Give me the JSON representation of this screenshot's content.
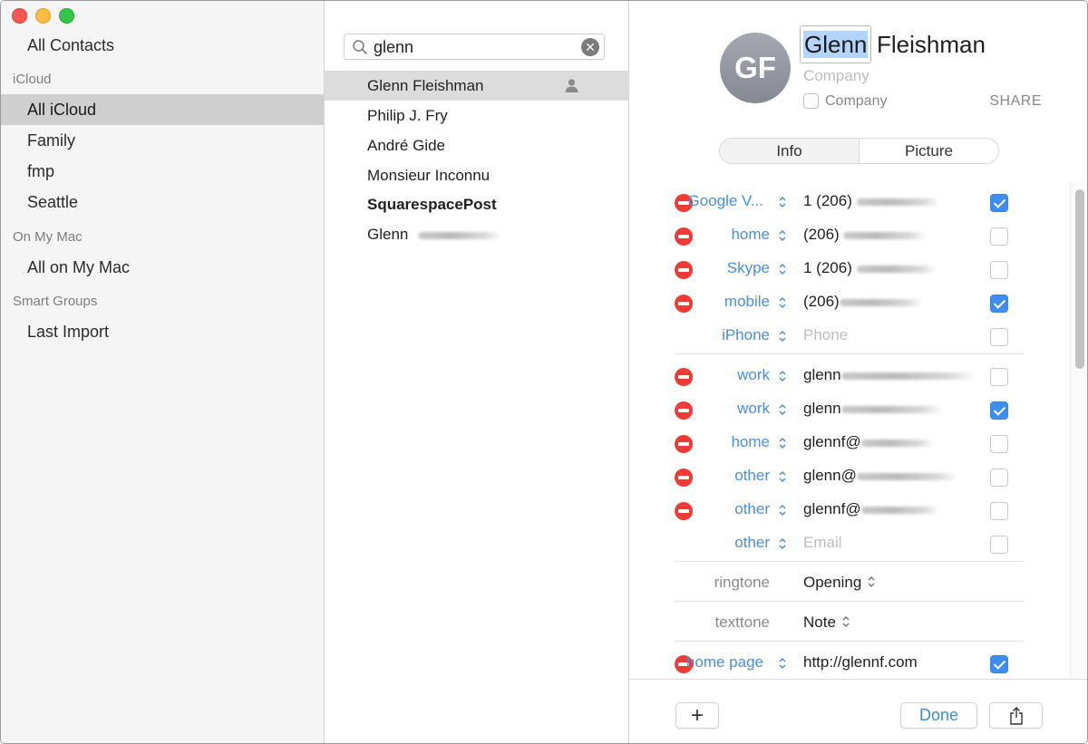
{
  "sidebar": {
    "top_item": "All Contacts",
    "groups": [
      {
        "header": "iCloud",
        "items": [
          "All iCloud",
          "Family",
          "fmp",
          "Seattle"
        ]
      },
      {
        "header": "On My Mac",
        "items": [
          "All on My Mac"
        ]
      },
      {
        "header": "Smart Groups",
        "items": [
          "Last Import"
        ]
      }
    ],
    "selected": "All iCloud"
  },
  "search": {
    "value": "glenn",
    "icon": "search-icon",
    "clear_icon": "clear-icon"
  },
  "contacts": [
    {
      "name": "Glenn Fleishman",
      "selected": true,
      "me": true,
      "bold": false
    },
    {
      "name": "Philip J. Fry",
      "selected": false,
      "bold": false
    },
    {
      "name": "André Gide",
      "selected": false,
      "bold": false
    },
    {
      "name": "Monsieur Inconnu",
      "selected": false,
      "bold": false
    },
    {
      "name": "SquarespacePost",
      "selected": false,
      "bold": true
    },
    {
      "name": "Glenn",
      "redacted": true,
      "selected": false,
      "bold": false
    }
  ],
  "card": {
    "initials": "GF",
    "first_name": "Glenn",
    "last_name": "Fleishman",
    "company_placeholder": "Company",
    "company_checkbox_label": "Company",
    "company_checked": false,
    "share_label": "SHARE",
    "tabs": [
      "Info",
      "Picture"
    ],
    "phones": [
      {
        "label": "Google V...",
        "value": "1 (206)",
        "redacted": true,
        "checked": true,
        "removable": true
      },
      {
        "label": "home",
        "value": "(206)",
        "redacted": true,
        "checked": false,
        "removable": true
      },
      {
        "label": "Skype",
        "value": "1 (206)",
        "redacted": true,
        "checked": false,
        "removable": true
      },
      {
        "label": "mobile",
        "value": "(206)",
        "redacted": true,
        "checked": true,
        "removable": true
      },
      {
        "label": "iPhone",
        "placeholder": "Phone",
        "checked": false,
        "removable": false
      }
    ],
    "emails": [
      {
        "label": "work",
        "value": "glenn",
        "redacted": true,
        "checked": false,
        "removable": true
      },
      {
        "label": "work",
        "value": "glenn",
        "redacted": true,
        "checked": true,
        "removable": true
      },
      {
        "label": "home",
        "value": "glennf@",
        "redacted": true,
        "checked": false,
        "removable": true
      },
      {
        "label": "other",
        "value": "glenn@",
        "redacted": true,
        "checked": false,
        "removable": true
      },
      {
        "label": "other",
        "value": "glennf@",
        "redacted": true,
        "checked": false,
        "removable": true
      },
      {
        "label": "other",
        "placeholder": "Email",
        "checked": false,
        "removable": false
      }
    ],
    "ringtone": {
      "label": "ringtone",
      "value": "Opening"
    },
    "texttone": {
      "label": "texttone",
      "value": "Note"
    },
    "homepage": {
      "label": "home page",
      "value": "http://glennf.com",
      "checked": true,
      "removable": true
    }
  },
  "footer": {
    "add_label": "+",
    "done_label": "Done",
    "share_icon": "share-icon"
  },
  "colors": {
    "accent": "#3d8ef0",
    "label_blue": "#4b8fd6",
    "remove_red": "#ee3b36",
    "selection": "#cfcfcf"
  }
}
